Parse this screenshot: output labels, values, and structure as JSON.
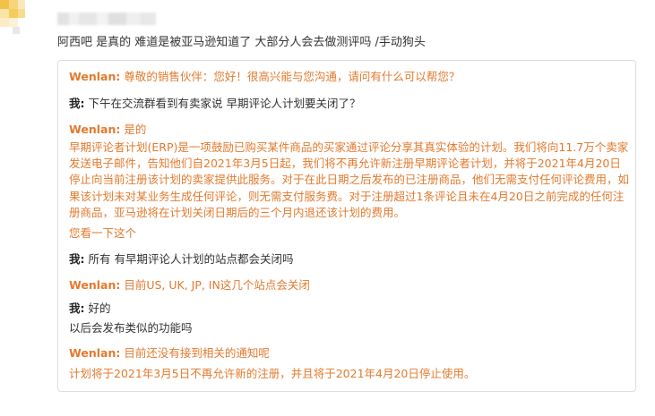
{
  "post": {
    "text": "阿西吧 是真的 难道是被亚马逊知道了 大部分人会去做测评吗 /手动狗头"
  },
  "chat": {
    "lines": [
      {
        "speaker": "Wenlan:",
        "text": " 尊敬的销售伙伴：您好！很高兴能与您沟通，请问有什么可以帮您？"
      },
      {
        "speaker": "我:",
        "text": " 下午在交流群看到有卖家说 早期评论人计划要关闭了？"
      },
      {
        "speaker": "Wenlan:",
        "text": " 是的"
      },
      {
        "speaker": "",
        "text": "早期评论者计划(ERP)是一项鼓励已购买某件商品的买家通过评论分享其真实体验的计划。我们将向11.7万个卖家发送电子邮件，告知他们自2021年3月5日起，我们将不再允许新注册早期评论者计划，并将于2021年4月20日停止向当前注册该计划的卖家提供此服务。对于在此日期之后发布的已注册商品，他们无需支付任何评论费用，如果该计划未对某业务生成任何评论，则无需支付服务费。对于注册超过1条评论且未在4月20日之前完成的任何注册商品，亚马逊将在计划关闭日期后的三个月内退还该计划的费用。"
      },
      {
        "speaker": "",
        "text": "您看一下这个"
      },
      {
        "speaker": "我:",
        "text": " 所有 有早期评论人计划的站点都会关闭吗"
      },
      {
        "speaker": "Wenlan:",
        "text": " 目前US, UK, JP, IN这几个站点会关闭"
      },
      {
        "speaker": "我:",
        "text": " 好的"
      },
      {
        "speaker": "",
        "text": "以后会发布类似的功能吗"
      },
      {
        "speaker": "Wenlan:",
        "text": " 目前还没有接到相关的通知呢"
      },
      {
        "speaker": "",
        "text": "计划将于2021年3月5日不再允许新的注册，并且将于2021年4月20日停止使用。"
      }
    ]
  },
  "colors": {
    "agent": "#e27a2e",
    "user": "#333333",
    "border": "#dddddd"
  }
}
